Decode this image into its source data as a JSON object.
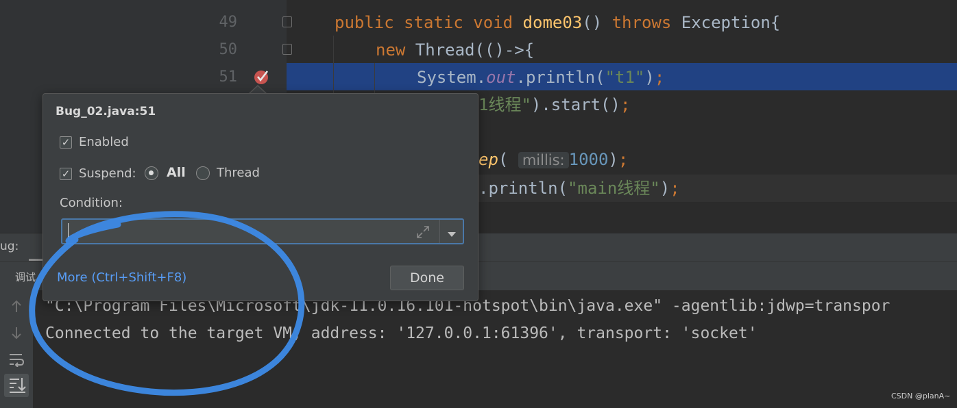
{
  "editor": {
    "lines": [
      {
        "num": "49"
      },
      {
        "num": "50"
      },
      {
        "num": "51"
      }
    ],
    "code": {
      "l49_kw": "public static void ",
      "l49_fn": "dome03",
      "l49_paren": "() ",
      "l49_throws": "throws",
      "l49_rest": " Exception{",
      "l50_new": "new ",
      "l50_rest": "Thread(()->{",
      "l51_sys": "System.",
      "l51_out": "out",
      "l51_call": ".println(",
      "l51_str": "\"t1\"",
      "l51_end": ")",
      "l51_semi": ";",
      "l52_str": "1线程\"",
      "l52_rest": ").start()",
      "l52_semi": ";",
      "l54_fn": "ep",
      "l54_paren": "(",
      "l54_hint": "millis:",
      "l54_num": "1000",
      "l54_close": ")",
      "l54_semi": ";",
      "l55_call": ".println(",
      "l55_str": "\"main线程\"",
      "l55_close": ")",
      "l55_semi": ";"
    }
  },
  "debug": {
    "title_fragment": "ug:",
    "tab_fragment": "调试",
    "console_lines": [
      "\"C:\\Program Files\\Microsoft\\jdk-11.0.16.101-hotspot\\bin\\java.exe\" -agentlib:jdwp=transpor",
      "Connected to the target VM, address: '127.0.0.1:61396', transport: 'socket'"
    ]
  },
  "popup": {
    "title": "Bug_02.java:51",
    "enabled_label": "Enabled",
    "enabled_checked": "✓",
    "suspend_label": "Suspend:",
    "suspend_checked": "✓",
    "all_label": "All",
    "thread_label": "Thread",
    "condition_label": "Condition:",
    "condition_value": "",
    "more_link": "More (Ctrl+Shift+F8)",
    "done_label": "Done"
  },
  "watermark": "CSDN @planA~",
  "colors": {
    "accent_link": "#589df6",
    "annotation_circle": "#3d8ae6",
    "breakpoint": "#c75450",
    "selection": "#214283"
  }
}
